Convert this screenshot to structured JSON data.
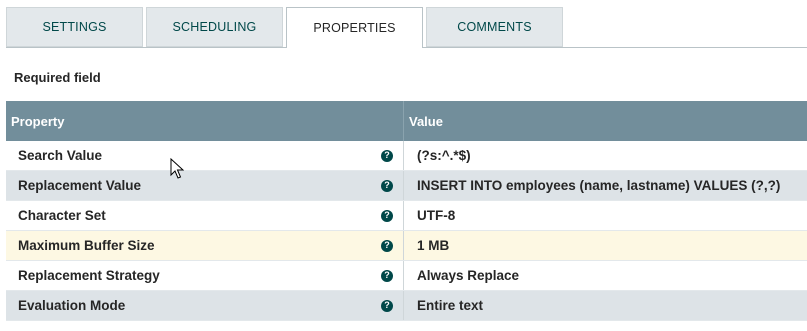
{
  "tabs": [
    {
      "label": "SETTINGS",
      "active": false
    },
    {
      "label": "SCHEDULING",
      "active": false
    },
    {
      "label": "PROPERTIES",
      "active": true
    },
    {
      "label": "COMMENTS",
      "active": false
    }
  ],
  "required_label": "Required field",
  "table": {
    "headers": {
      "property": "Property",
      "value": "Value"
    },
    "rows": [
      {
        "property": "Search Value",
        "value": "(?s:^.*$)"
      },
      {
        "property": "Replacement Value",
        "value": "INSERT INTO employees (name, lastname) VALUES (?,?)"
      },
      {
        "property": "Character Set",
        "value": "UTF-8"
      },
      {
        "property": "Maximum Buffer Size",
        "value": "1 MB"
      },
      {
        "property": "Replacement Strategy",
        "value": "Always Replace"
      },
      {
        "property": "Evaluation Mode",
        "value": "Entire text"
      }
    ]
  },
  "icons": {
    "help": "question-circle-icon",
    "cursor": "mouse-pointer-icon"
  },
  "colors": {
    "header_bg": "#728e9b",
    "tab_bg": "#e3e8eb",
    "tab_text": "#004849",
    "row_alt_bg": "#dde3e7",
    "row_highlight_bg": "#fdf8e3",
    "help_icon": "#004849"
  }
}
